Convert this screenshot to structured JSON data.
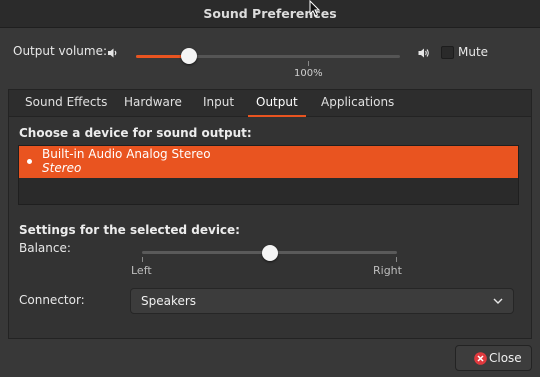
{
  "window": {
    "title": "Sound Preferences"
  },
  "volume": {
    "label": "Output volume:",
    "level_percent": 20,
    "mark": "100%",
    "mute_label": "Mute",
    "muted": false
  },
  "tabs": [
    {
      "label": "Sound Effects"
    },
    {
      "label": "Hardware"
    },
    {
      "label": "Input"
    },
    {
      "label": "Output",
      "active": true
    },
    {
      "label": "Applications"
    }
  ],
  "output": {
    "device_heading": "Choose a device for sound output:",
    "devices": [
      {
        "name": "Built-in Audio Analog Stereo",
        "profile": "Stereo",
        "selected": true
      }
    ],
    "settings_heading": "Settings for the selected device:",
    "balance": {
      "label": "Balance:",
      "value": 0.5,
      "left_label": "Left",
      "right_label": "Right"
    },
    "connector": {
      "label": "Connector:",
      "value": "Speakers"
    }
  },
  "close_button": {
    "label": "Close"
  },
  "colors": {
    "accent": "#e95420",
    "background": "#383838",
    "titlebar": "#2b2b2b",
    "close_icon": "#e0393e"
  },
  "icons": [
    "speaker-low-icon",
    "speaker-high-icon",
    "chevron-down-icon",
    "close-circle-icon",
    "mouse-cursor-icon"
  ]
}
